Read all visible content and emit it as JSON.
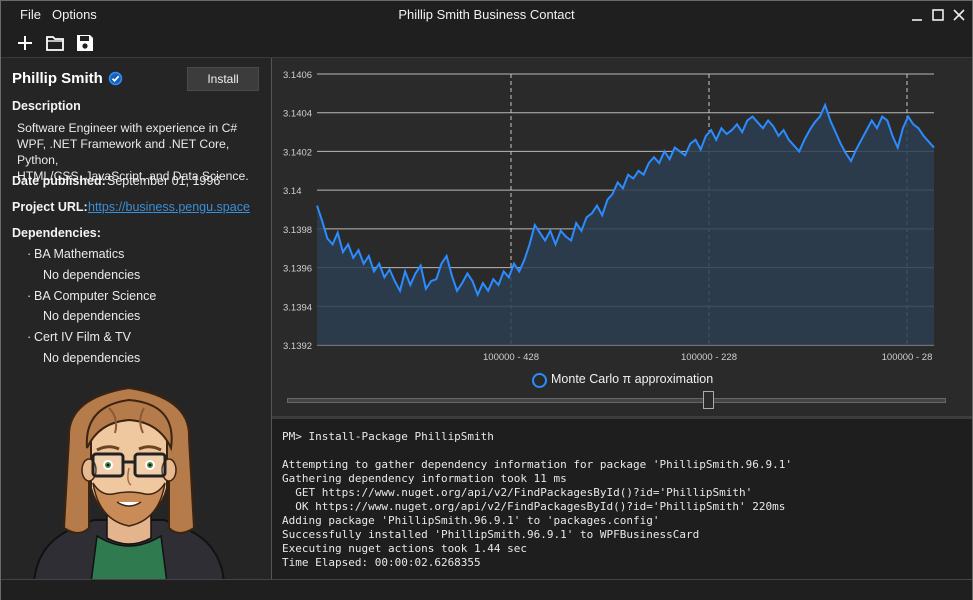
{
  "window": {
    "title": "Phillip Smith Business Contact",
    "menu": [
      "File",
      "Options"
    ]
  },
  "toolbar": {
    "icons": [
      "plus-icon",
      "folder-icon",
      "save-icon"
    ]
  },
  "profile": {
    "name": "Phillip Smith",
    "install_label": "Install",
    "description_label": "Description",
    "description_lines": [
      "Software Engineer with experience in C#",
      "WPF, .NET Framework and .NET Core, Python,",
      "HTML/CSS, JavaScript, and Data Science."
    ],
    "date_label": "Date published:",
    "date_value": "September 01, 1996",
    "url_label": "Project URL:",
    "url_value": "https://business.pengu.space",
    "dependencies_label": "Dependencies:",
    "dependencies": [
      {
        "name": "BA Mathematics",
        "detail": "No dependencies"
      },
      {
        "name": "BA Computer Science",
        "detail": "No dependencies"
      },
      {
        "name": "Cert IV Film & TV",
        "detail": "No dependencies"
      }
    ]
  },
  "chart_data": {
    "type": "area",
    "title": "",
    "xlabel": "",
    "ylabel": "",
    "ylim": [
      3.1392,
      3.1406
    ],
    "yticks": [
      "3.1406",
      "3.1404",
      "3.1402",
      "3.14",
      "3.1398",
      "3.1396",
      "3.1394",
      "3.1392"
    ],
    "xtick_labels": [
      "100000 - 428",
      "100000 - 228",
      "100000 - 28"
    ],
    "grid": true,
    "legend_position": "bottom-center",
    "series": [
      {
        "name": "Monte Carlo π approximation",
        "color": "#2b8cff",
        "values": [
          3.13992,
          3.13984,
          3.13975,
          3.13972,
          3.13978,
          3.13968,
          3.13972,
          3.13965,
          3.13969,
          3.13962,
          3.13966,
          3.13958,
          3.13962,
          3.13955,
          3.13959,
          3.13953,
          3.13948,
          3.13958,
          3.13951,
          3.13957,
          3.13961,
          3.13949,
          3.13953,
          3.13954,
          3.13962,
          3.13966,
          3.13956,
          3.13948,
          3.13952,
          3.13957,
          3.13953,
          3.13946,
          3.13952,
          3.13948,
          3.13954,
          3.13951,
          3.13958,
          3.13955,
          3.13962,
          3.13958,
          3.13964,
          3.13972,
          3.13982,
          3.13978,
          3.13974,
          3.13979,
          3.13972,
          3.13979,
          3.13976,
          3.13974,
          3.13983,
          3.13979,
          3.13986,
          3.13988,
          3.13992,
          3.13987,
          3.13995,
          3.13998,
          3.14004,
          3.14001,
          3.14008,
          3.14006,
          3.1401,
          3.14008,
          3.14014,
          3.14017,
          3.14014,
          3.1402,
          3.14016,
          3.14022,
          3.1402,
          3.14018,
          3.14024,
          3.14026,
          3.14021,
          3.14028,
          3.14031,
          3.14026,
          3.14032,
          3.14029,
          3.14031,
          3.14034,
          3.1403,
          3.14036,
          3.14038,
          3.14035,
          3.14032,
          3.14036,
          3.14033,
          3.14028,
          3.14031,
          3.14026,
          3.14023,
          3.1402,
          3.14026,
          3.14031,
          3.14035,
          3.14038,
          3.14044,
          3.14036,
          3.1403,
          3.14024,
          3.14019,
          3.14015,
          3.14021,
          3.14026,
          3.14031,
          3.14036,
          3.14032,
          3.14038,
          3.14036,
          3.14028,
          3.14022,
          3.14032,
          3.14038,
          3.14034,
          3.14032,
          3.14028,
          3.14025,
          3.14022
        ]
      }
    ]
  },
  "console": {
    "lines": [
      "PM> Install-Package PhillipSmith",
      "",
      "Attempting to gather dependency information for package 'PhillipSmith.96.9.1'",
      "Gathering dependency information took 11 ms",
      "  GET https://www.nuget.org/api/v2/FindPackagesById()?id='PhillipSmith'",
      "  OK https://www.nuget.org/api/v2/FindPackagesById()?id='PhillipSmith' 220ms",
      "Adding package 'PhillipSmith.96.9.1' to 'packages.config'",
      "Successfully installed 'PhillipSmith.96.9.1' to WPFBusinessCard",
      "Executing nuget actions took 1.44 sec",
      "Time Elapsed: 00:00:02.6268355"
    ]
  },
  "colors": {
    "accent": "#2b8cff",
    "link": "#3a8fd6",
    "background": "#252526"
  }
}
